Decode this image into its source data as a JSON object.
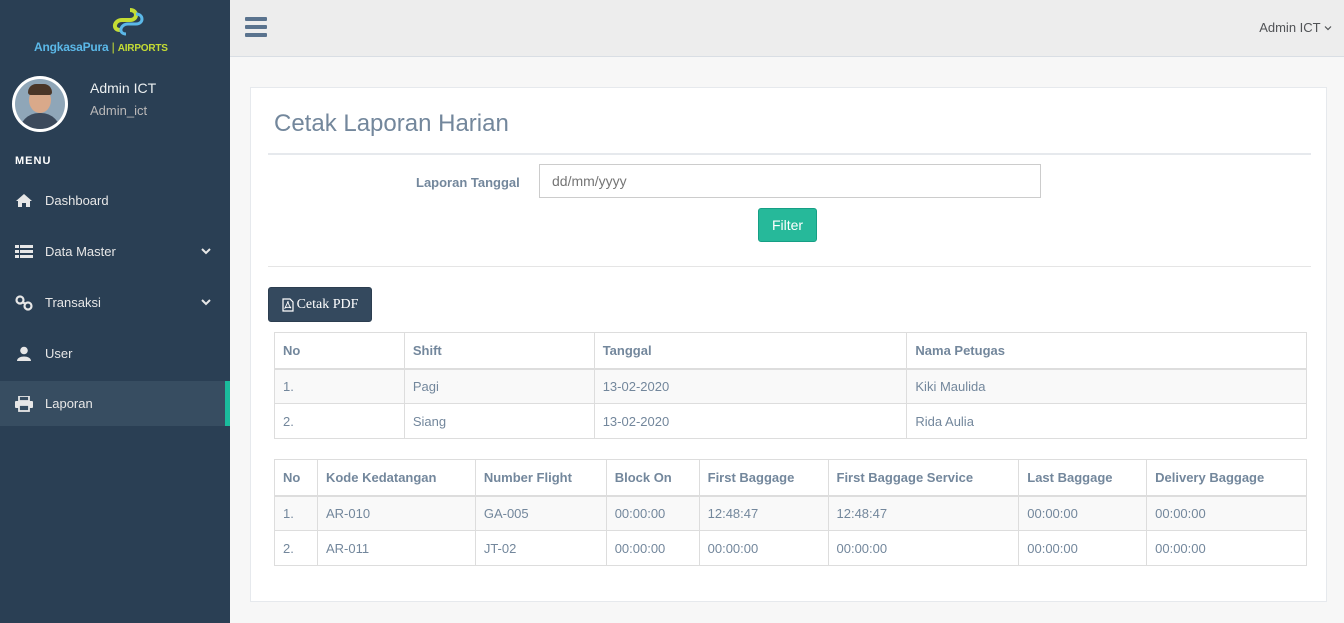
{
  "brand": {
    "name_main": "AngkasaPura",
    "name_sep": "|",
    "name_sub": "AIRPORTS"
  },
  "profile": {
    "name": "Admin ICT",
    "username": "Admin_ict"
  },
  "sidebar": {
    "menu_title": "MENU",
    "items": [
      {
        "label": "Dashboard",
        "icon": "home-icon",
        "has_submenu": false,
        "active": false
      },
      {
        "label": "Data Master",
        "icon": "list-icon",
        "has_submenu": true,
        "active": false
      },
      {
        "label": "Transaksi",
        "icon": "link-icon",
        "has_submenu": true,
        "active": false
      },
      {
        "label": "User",
        "icon": "user-icon",
        "has_submenu": false,
        "active": false
      },
      {
        "label": "Laporan",
        "icon": "printer-icon",
        "has_submenu": false,
        "active": true
      }
    ]
  },
  "topnav": {
    "user_label": "Admin ICT"
  },
  "page": {
    "title": "Cetak Laporan Harian",
    "form": {
      "date_label": "Laporan Tanggal",
      "date_placeholder": "dd/mm/yyyy",
      "filter_label": "Filter"
    },
    "pdf_button_label": "Cetak PDF"
  },
  "shift_table": {
    "headers": [
      "No",
      "Shift",
      "Tanggal",
      "Nama Petugas"
    ],
    "rows": [
      [
        "1.",
        "Pagi",
        "13-02-2020",
        "Kiki Maulida"
      ],
      [
        "2.",
        "Siang",
        "13-02-2020",
        "Rida Aulia"
      ]
    ]
  },
  "flight_table": {
    "headers": [
      "No",
      "Kode Kedatangan",
      "Number Flight",
      "Block On",
      "First Baggage",
      "First Baggage Service",
      "Last Baggage",
      "Delivery Baggage"
    ],
    "rows": [
      [
        "1.",
        "AR-010",
        "GA-005",
        "00:00:00",
        "12:48:47",
        "12:48:47",
        "00:00:00",
        "00:00:00"
      ],
      [
        "2.",
        "AR-011",
        "JT-02",
        "00:00:00",
        "00:00:00",
        "00:00:00",
        "00:00:00",
        "00:00:00"
      ]
    ]
  },
  "colors": {
    "sidebar_bg": "#2a3f54",
    "accent": "#1abb9c",
    "filter_btn": "#26b99a",
    "pdf_btn": "#34495e"
  }
}
